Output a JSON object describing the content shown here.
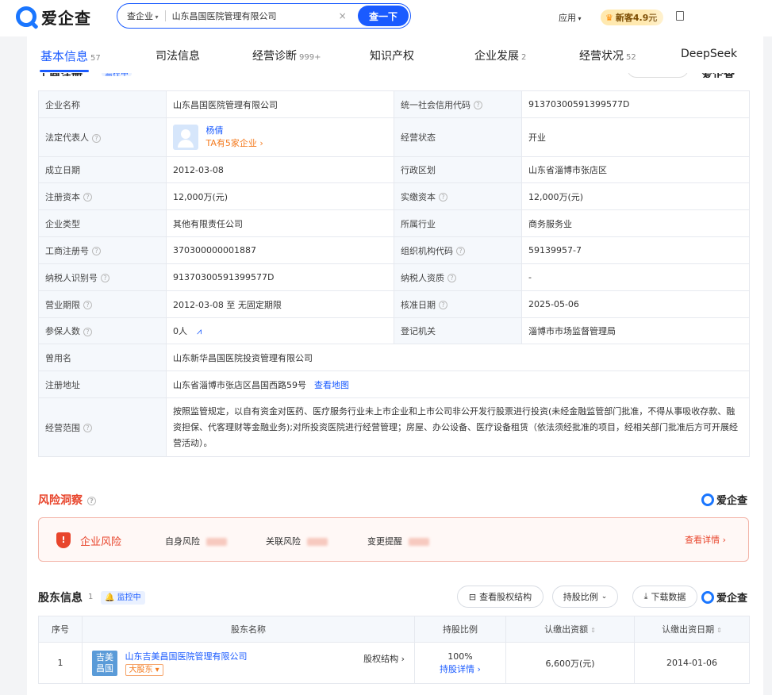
{
  "header": {
    "logo_text": "爱企查",
    "search_scope": "查企业",
    "search_value": "山东昌国医院管理有限公司",
    "clear_symbol": "×",
    "search_button": "查一下",
    "apps_label": "应用",
    "new_badge": "新客4.9元"
  },
  "tabs": [
    {
      "label": "基本信息",
      "count": "57"
    },
    {
      "label": "司法信息",
      "count": ""
    },
    {
      "label": "经营诊断",
      "count": "999+"
    },
    {
      "label": "知识产权",
      "count": ""
    },
    {
      "label": "企业发展",
      "count": "2"
    },
    {
      "label": "经营状况",
      "count": "52"
    },
    {
      "label": "DeepSeek",
      "count": ""
    }
  ],
  "registration": {
    "title_cut": "工商注册",
    "monitor_cut": "监控中",
    "download_cut": "下载数据",
    "brand_cut": "爱企查"
  },
  "info": {
    "company_name_label": "企业名称",
    "company_name": "山东昌国医院管理有限公司",
    "credit_code_label": "统一社会信用代码",
    "credit_code": "91370300591399577D",
    "legal_rep_label": "法定代表人",
    "legal_rep_name": "杨倩",
    "legal_rep_link": "TA有5家企业 ›",
    "status_label": "经营状态",
    "status": "开业",
    "founded_label": "成立日期",
    "founded": "2012-03-08",
    "district_label": "行政区划",
    "district": "山东省淄博市张店区",
    "reg_capital_label": "注册资本",
    "reg_capital": "12,000万(元)",
    "paid_capital_label": "实缴资本",
    "paid_capital": "12,000万(元)",
    "type_label": "企业类型",
    "type": "其他有限责任公司",
    "industry_label": "所属行业",
    "industry": "商务服务业",
    "reg_no_label": "工商注册号",
    "reg_no": "370300000001887",
    "org_code_label": "组织机构代码",
    "org_code": "59139957-7",
    "taxpayer_id_label": "纳税人识别号",
    "taxpayer_id": "91370300591399577D",
    "taxpayer_qual_label": "纳税人资质",
    "taxpayer_qual": "-",
    "term_label": "营业期限",
    "term": "2012-03-08 至 无固定期限",
    "approved_label": "核准日期",
    "approved": "2025-05-06",
    "insured_label": "参保人数",
    "insured": "0人",
    "authority_label": "登记机关",
    "authority": "淄博市市场监督管理局",
    "former_name_label": "曾用名",
    "former_name": "山东新华昌国医院投资管理有限公司",
    "address_label": "注册地址",
    "address": "山东省淄博市张店区昌国西路59号",
    "map_link": "查看地图",
    "scope_label": "经营范围",
    "scope": "按照监管规定，以自有资金对医药、医疗服务行业未上市企业和上市公司非公开发行股票进行投资(未经金融监管部门批准，不得从事吸收存款、融资担保、代客理财等金融业务);对所投资医院进行经营管理；房屋、办公设备、医疗设备租赁（依法须经批准的项目，经相关部门批准后方可开展经营活动）。"
  },
  "risk": {
    "title": "风险洞察",
    "brand": "爱企查",
    "enterprise_risk": "企业风险",
    "self_risk": "自身风险",
    "related_risk": "关联风险",
    "change_alert": "变更提醒",
    "details": "查看详情 ›"
  },
  "shareholders": {
    "title": "股东信息",
    "count": "1",
    "monitor": "监控中",
    "equity_structure_btn": "查看股权结构",
    "ratio_btn": "持股比例",
    "download_btn": "下载数据",
    "brand": "爱企查",
    "columns": [
      "序号",
      "股东名称",
      "持股比例",
      "认缴出资额",
      "认缴出资日期"
    ],
    "rows": [
      {
        "index": "1",
        "logo_text": "吉美昌国",
        "name": "山东吉美昌国医院管理有限公司",
        "tag": "大股东 ▾",
        "structure_link": "股权结构 ›",
        "ratio": "100%",
        "ratio_link": "持股详情 ›",
        "amount": "6,600万(元)",
        "date": "2014-01-06"
      }
    ]
  }
}
